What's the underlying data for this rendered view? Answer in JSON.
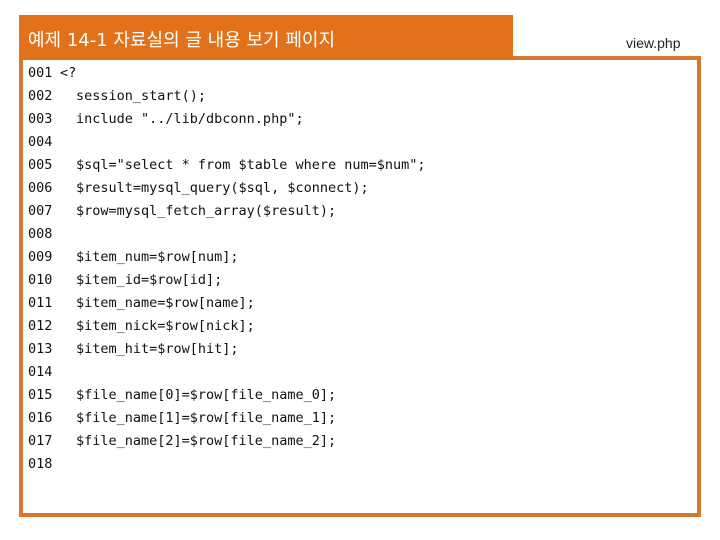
{
  "header": {
    "title": "예제 14-1 자료실의 글 내용 보기 페이지"
  },
  "file": {
    "name": "view.php"
  },
  "colors": {
    "accent": "#e2711b",
    "border": "#d8772b"
  },
  "code": {
    "lines": [
      {
        "num": "001",
        "text": "<?",
        "indent": false
      },
      {
        "num": "002",
        "text": "session_start();",
        "indent": true
      },
      {
        "num": "003",
        "text": "include \"../lib/dbconn.php\";",
        "indent": true
      },
      {
        "num": "004",
        "text": "",
        "indent": true
      },
      {
        "num": "005",
        "text": "$sql=\"select * from $table where num=$num\";",
        "indent": true
      },
      {
        "num": "006",
        "text": "$result=mysql_query($sql, $connect);",
        "indent": true
      },
      {
        "num": "007",
        "text": "$row=mysql_fetch_array($result);",
        "indent": true
      },
      {
        "num": "008",
        "text": "",
        "indent": true
      },
      {
        "num": "009",
        "text": "$item_num=$row[num];",
        "indent": true
      },
      {
        "num": "010",
        "text": "$item_id=$row[id];",
        "indent": true
      },
      {
        "num": "011",
        "text": "$item_name=$row[name];",
        "indent": true
      },
      {
        "num": "012",
        "text": "$item_nick=$row[nick];",
        "indent": true
      },
      {
        "num": "013",
        "text": "$item_hit=$row[hit];",
        "indent": true
      },
      {
        "num": "014",
        "text": "",
        "indent": true
      },
      {
        "num": "015",
        "text": "$file_name[0]=$row[file_name_0];",
        "indent": true
      },
      {
        "num": "016",
        "text": "$file_name[1]=$row[file_name_1];",
        "indent": true
      },
      {
        "num": "017",
        "text": "$file_name[2]=$row[file_name_2];",
        "indent": true
      },
      {
        "num": "018",
        "text": "",
        "indent": true
      }
    ]
  }
}
